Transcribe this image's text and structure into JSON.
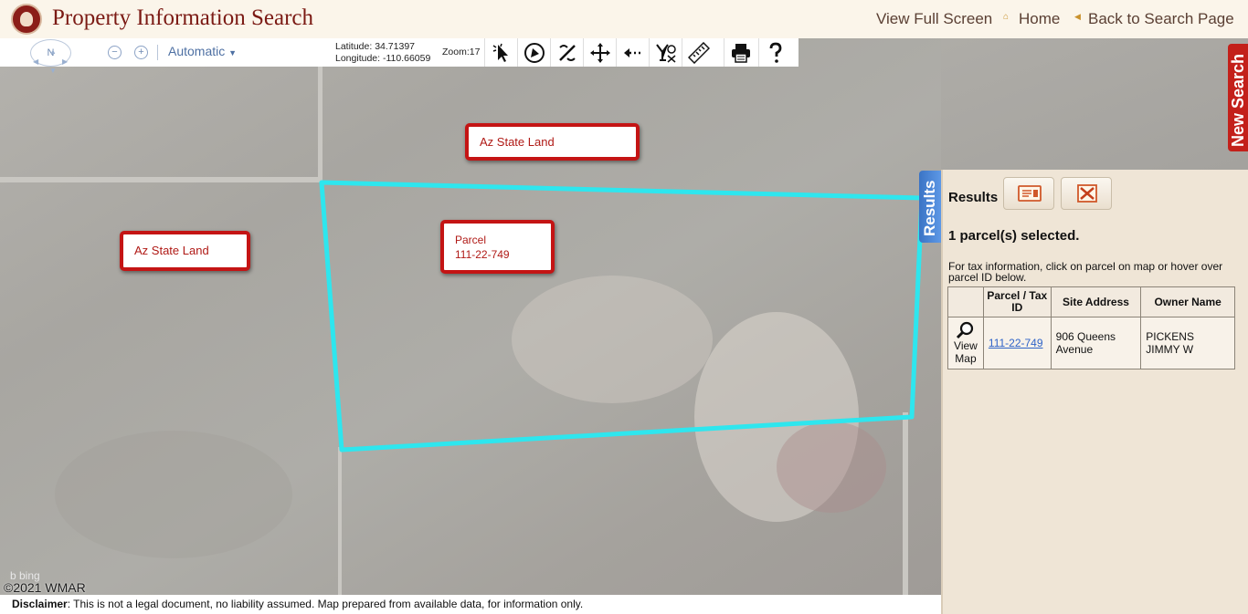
{
  "header": {
    "title": "Property Information Search",
    "links": {
      "full_screen": "View Full Screen",
      "home": "Home",
      "back": "Back to Search Page"
    }
  },
  "toolbar": {
    "compass_label": "N",
    "zoom_out_label": "−",
    "zoom_in_label": "+",
    "basemap_mode": "Automatic",
    "latitude": "Latitude: 34.71397",
    "longitude": "Longitude: -110.66059",
    "zoom": "Zoom:17",
    "tools": [
      "select-tool",
      "polygon-select-tool",
      "percent-tool",
      "pan-tool",
      "back-extent-tool",
      "identify-tool",
      "measure-tool",
      "print-tool",
      "help-tool"
    ]
  },
  "map": {
    "labels": {
      "state_land_north": "Az State Land",
      "state_land_west": "Az State Land",
      "parcel_title": "Parcel",
      "parcel_id": "111-22-749"
    },
    "watermark": "©2021 WMAR",
    "bing": "b bing",
    "parcel_outline_color": "#2ee6ee",
    "label_border_color": "#c41414"
  },
  "side_tabs": {
    "results": "Results",
    "new_search": "New Search"
  },
  "results": {
    "title": "Results",
    "selected_count": "1 parcel(s) selected.",
    "instructions": "For tax information, click on parcel on map or hover over parcel ID below.",
    "columns": [
      "",
      "Parcel / Tax ID",
      "Site Address",
      "Owner Name"
    ],
    "rows": [
      {
        "view_map": "View Map",
        "parcel_id": "111-22-749",
        "site_address": "906 Queens Avenue",
        "owner": "PICKENS JIMMY W"
      }
    ]
  },
  "footer": {
    "disclaimer_label": "Disclaimer",
    "disclaimer_text": ": This is not a legal document, no liability assumed. Map prepared from available data, for information only."
  }
}
